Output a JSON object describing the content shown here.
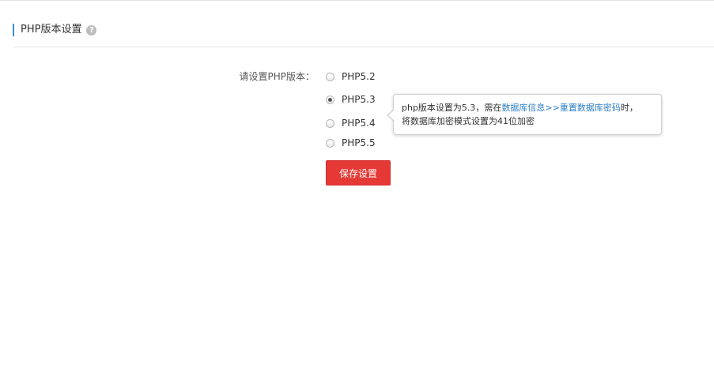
{
  "section": {
    "title": "PHP版本设置",
    "help_icon": "question-icon",
    "help_symbol": "?"
  },
  "form": {
    "label": "请设置PHP版本：",
    "options": [
      {
        "label": "PHP5.2",
        "checked": false
      },
      {
        "label": "PHP5.3",
        "checked": true
      },
      {
        "label": "PHP5.4",
        "checked": false
      },
      {
        "label": "PHP5.5",
        "checked": false
      }
    ],
    "save_label": "保存设置"
  },
  "tooltip": {
    "line1_prefix": "php版本设置为5.3，需在",
    "link1": "数据库信息",
    "link_separator": ">>",
    "link2": "重置数据库密码",
    "line1_suffix": "时，",
    "line2": "将数据库加密模式设置为41位加密"
  },
  "colors": {
    "accent_bar": "#3a8fd6",
    "save_button": "#e53935",
    "link": "#2f7fc8"
  }
}
